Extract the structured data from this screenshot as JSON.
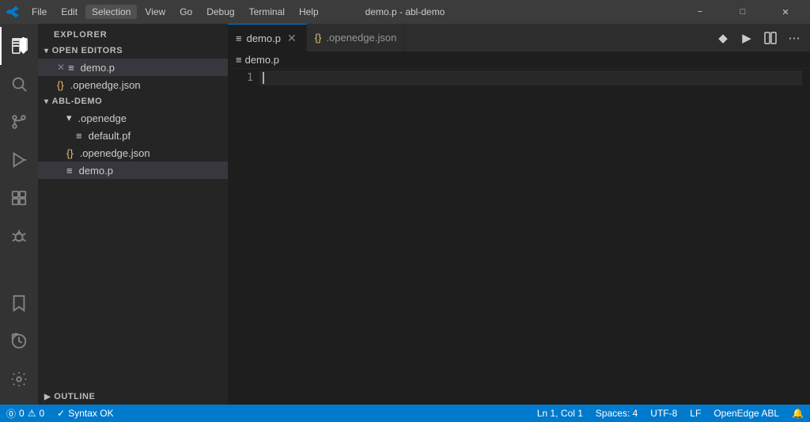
{
  "titlebar": {
    "title": "demo.p - abl-demo",
    "menus": [
      "File",
      "Edit",
      "Selection",
      "View",
      "Go",
      "Debug",
      "Terminal",
      "Help"
    ]
  },
  "activity_bar": {
    "icons": [
      {
        "name": "explorer-icon",
        "symbol": "⧉",
        "active": true
      },
      {
        "name": "search-icon",
        "symbol": "🔍",
        "active": false
      },
      {
        "name": "source-control-icon",
        "symbol": "⑂",
        "active": false
      },
      {
        "name": "run-icon",
        "symbol": "▷",
        "active": false
      },
      {
        "name": "extensions-icon",
        "symbol": "⊞",
        "active": false
      },
      {
        "name": "debug-icon",
        "symbol": "🐛",
        "active": false
      }
    ],
    "bottom_icons": [
      {
        "name": "bookmark-icon",
        "symbol": "🔖"
      },
      {
        "name": "history-icon",
        "symbol": "⏱"
      }
    ]
  },
  "sidebar": {
    "header": "Explorer",
    "sections": {
      "open_editors": {
        "label": "Open Editors",
        "files": [
          {
            "name": "demo.p",
            "icon": "≡",
            "color": "#cccccc",
            "active": true,
            "closeable": true
          },
          {
            "name": ".openedge.json",
            "icon": "{}",
            "color": "#e8c06e",
            "active": false
          }
        ]
      },
      "project": {
        "label": "ABL-DEMO",
        "items": [
          {
            "name": ".openedge",
            "icon": "▾",
            "type": "folder",
            "indent": 1
          },
          {
            "name": "default.pf",
            "icon": "≡",
            "type": "file",
            "indent": 2
          },
          {
            "name": ".openedge.json",
            "icon": "{}",
            "color": "#e8c06e",
            "type": "file",
            "indent": 1
          },
          {
            "name": "demo.p",
            "icon": "≡",
            "type": "file",
            "indent": 1,
            "active": true
          }
        ]
      },
      "outline": {
        "label": "Outline"
      }
    }
  },
  "tabs": [
    {
      "name": "demo.p",
      "icon": "≡",
      "active": true,
      "closeable": true
    },
    {
      "name": ".openedge.json",
      "icon": "{}",
      "active": false,
      "closeable": false
    }
  ],
  "breadcrumb": {
    "text": "demo.p"
  },
  "editor": {
    "lines": [
      {
        "number": "1",
        "content": "",
        "active": true
      }
    ]
  },
  "toolbar": {
    "buttons": [
      {
        "name": "diamond-button",
        "symbol": "◆"
      },
      {
        "name": "run-button",
        "symbol": "▶"
      },
      {
        "name": "layout-button",
        "symbol": "⊞"
      },
      {
        "name": "more-button",
        "symbol": "⋯"
      }
    ]
  },
  "statusbar": {
    "left": [
      {
        "name": "error-count",
        "text": "⓪ 0"
      },
      {
        "name": "warning-count",
        "text": "⚠ 0"
      },
      {
        "name": "syntax-ok",
        "text": "✓ Syntax OK"
      }
    ],
    "right": [
      {
        "name": "cursor-position",
        "text": "Ln 1, Col 1"
      },
      {
        "name": "spaces",
        "text": "Spaces: 4"
      },
      {
        "name": "encoding",
        "text": "UTF-8"
      },
      {
        "name": "line-ending",
        "text": "LF"
      },
      {
        "name": "language",
        "text": "OpenEdge ABL"
      },
      {
        "name": "notification-icon",
        "text": "🔔"
      }
    ]
  }
}
